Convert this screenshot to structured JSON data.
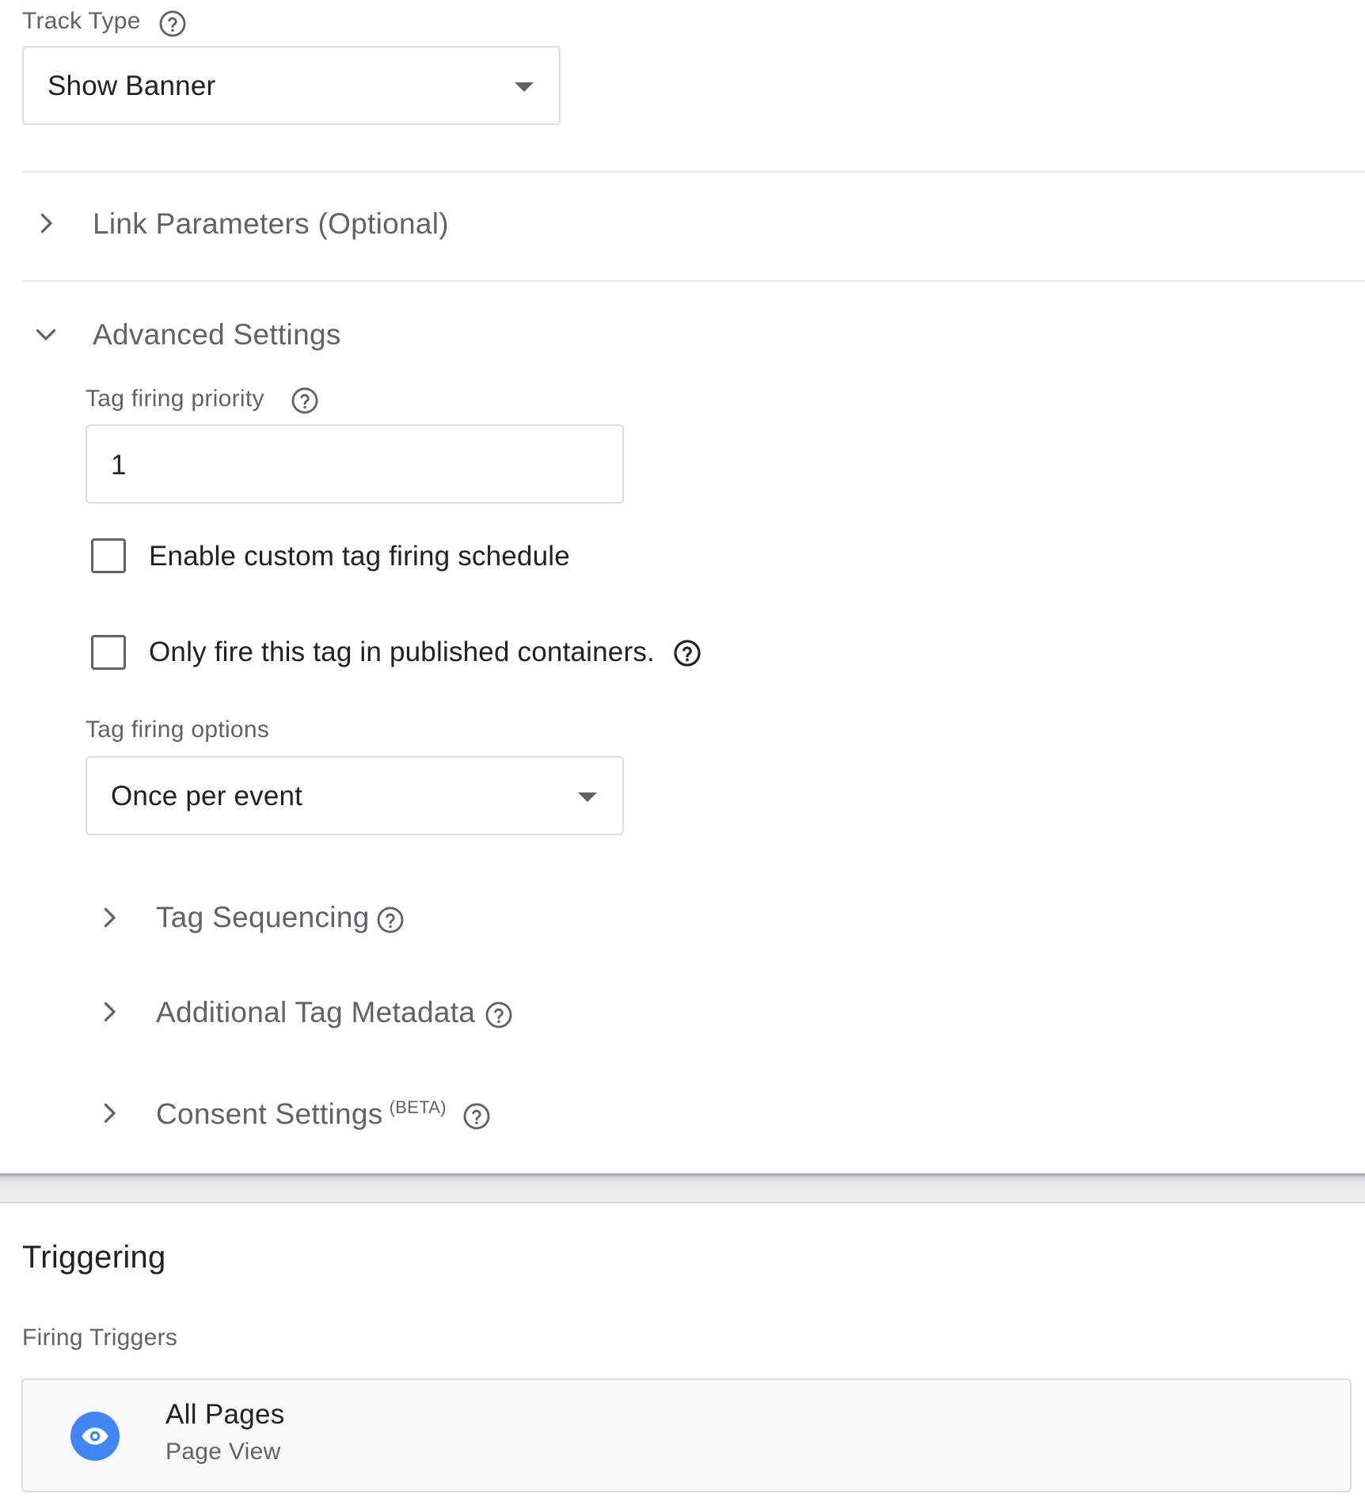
{
  "track_type": {
    "label": "Track Type",
    "value": "Show Banner"
  },
  "link_parameters": {
    "title": "Link Parameters (Optional)"
  },
  "advanced_settings": {
    "title": "Advanced Settings",
    "priority": {
      "label": "Tag firing priority",
      "value": "1"
    },
    "checkboxes": [
      {
        "label": "Enable custom tag firing schedule",
        "checked": false
      },
      {
        "label": "Only fire this tag in published containers.",
        "checked": false
      }
    ],
    "firing_options": {
      "label": "Tag firing options",
      "value": "Once per event"
    },
    "subsections": [
      {
        "title": "Tag Sequencing"
      },
      {
        "title": "Additional Tag Metadata"
      },
      {
        "title": "Consent Settings",
        "badge": "(BETA)"
      }
    ]
  },
  "triggering": {
    "title": "Triggering",
    "firing_triggers_label": "Firing Triggers",
    "trigger": {
      "name": "All Pages",
      "type": "Page View",
      "icon": "eye-icon",
      "icon_color": "#4285f4"
    }
  }
}
